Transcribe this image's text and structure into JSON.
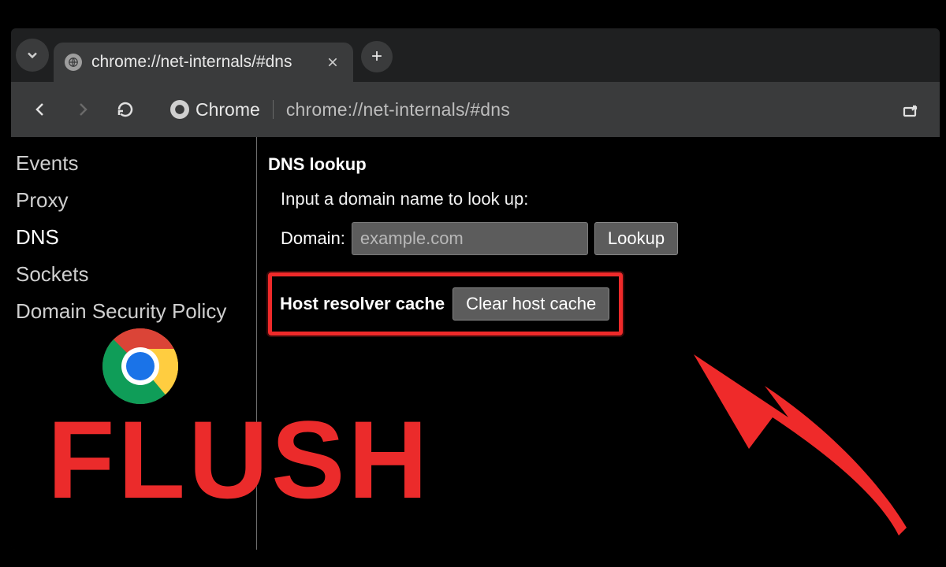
{
  "tab": {
    "title": "chrome://net-internals/#dns"
  },
  "toolbar": {
    "chip_label": "Chrome",
    "url": "chrome://net-internals/#dns"
  },
  "sidebar": {
    "items": [
      {
        "label": "Events"
      },
      {
        "label": "Proxy"
      },
      {
        "label": "DNS"
      },
      {
        "label": "Sockets"
      },
      {
        "label": "Domain Security Policy"
      }
    ],
    "active_index": 2
  },
  "main": {
    "section_title": "DNS lookup",
    "hint": "Input a domain name to look up:",
    "domain_label": "Domain:",
    "domain_placeholder": "example.com",
    "lookup_button": "Lookup",
    "cache_label": "Host resolver cache",
    "clear_button": "Clear host cache"
  },
  "overlay": {
    "flush_text": "FLUSH"
  }
}
